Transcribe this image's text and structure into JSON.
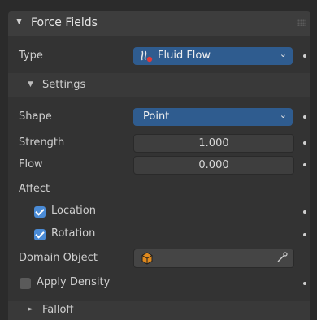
{
  "panel": {
    "title": "Force Fields"
  },
  "type_row": {
    "label": "Type",
    "value": "Fluid Flow",
    "icon": "fluid-flow-icon"
  },
  "settings": {
    "title": "Settings"
  },
  "shape": {
    "label": "Shape",
    "value": "Point"
  },
  "strength": {
    "label": "Strength",
    "value": "1.000"
  },
  "flow": {
    "label": "Flow",
    "value": "0.000"
  },
  "affect": {
    "label": "Affect",
    "location": {
      "label": "Location",
      "checked": true
    },
    "rotation": {
      "label": "Rotation",
      "checked": true
    }
  },
  "domain_object": {
    "label": "Domain Object",
    "icon": "object-cube-icon"
  },
  "apply_density": {
    "label": "Apply Density",
    "checked": false
  },
  "falloff": {
    "title": "Falloff"
  },
  "colors": {
    "accent": "#4a8bd6",
    "select": "#2f5c8f",
    "object_icon": "#e08a1e"
  }
}
